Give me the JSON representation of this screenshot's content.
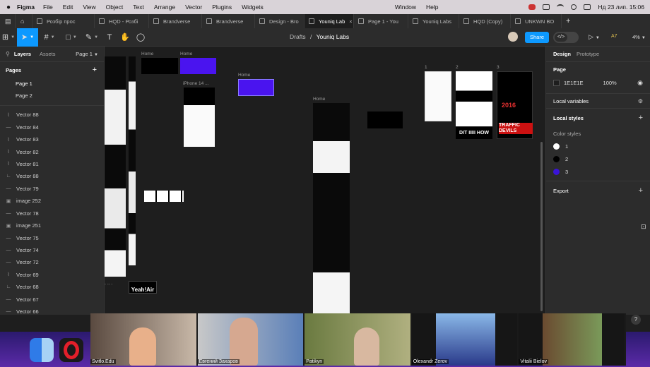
{
  "menubar": {
    "app": "Figma",
    "items": [
      "File",
      "Edit",
      "View",
      "Object",
      "Text",
      "Arrange",
      "Vector",
      "Plugins",
      "Widgets",
      "Window",
      "Help"
    ],
    "datetime": "Нд 23 лип.  15:06"
  },
  "tabs": [
    {
      "label": "Розбір прос",
      "active": false
    },
    {
      "label": "HQD - Розбі",
      "active": false
    },
    {
      "label": "Brandverse",
      "active": false
    },
    {
      "label": "Brandverse",
      "active": false
    },
    {
      "label": "Design - Bro",
      "active": false
    },
    {
      "label": "Youniq Lab",
      "active": true
    },
    {
      "label": "Page 1 - You",
      "active": false
    },
    {
      "label": "Youniq Labs",
      "active": false
    },
    {
      "label": "HQD (Copy)",
      "active": false
    },
    {
      "label": "UNKWN BO",
      "active": false
    }
  ],
  "toolbar": {
    "breadcrumb_parent": "Drafts",
    "breadcrumb_sep": "/",
    "breadcrumb_file": "Youniq Labs",
    "share_label": "Share",
    "code_label": "</>",
    "at_label": "A7",
    "zoom": "4%"
  },
  "left_panel": {
    "tab_layers": "Layers",
    "tab_assets": "Assets",
    "current_page": "Page 1",
    "pages_header": "Pages",
    "pages": [
      "Page 1",
      "Page 2"
    ],
    "layers": [
      {
        "icon": "⌇",
        "name": "Vector 88"
      },
      {
        "icon": "—",
        "name": "Vector 84"
      },
      {
        "icon": "⌇",
        "name": "Vector 83"
      },
      {
        "icon": "⌇",
        "name": "Vector 82"
      },
      {
        "icon": "⌇",
        "name": "Vector 81"
      },
      {
        "icon": "∟",
        "name": "Vector 88"
      },
      {
        "icon": "—",
        "name": "Vector 79"
      },
      {
        "icon": "▣",
        "name": "image 252"
      },
      {
        "icon": "—",
        "name": "Vector 78"
      },
      {
        "icon": "▣",
        "name": "image 251"
      },
      {
        "icon": "—",
        "name": "Vector 75"
      },
      {
        "icon": "—",
        "name": "Vector 74"
      },
      {
        "icon": "—",
        "name": "Vector 72"
      },
      {
        "icon": "⌇",
        "name": "Vector 69"
      },
      {
        "icon": "∟",
        "name": "Vector 68"
      },
      {
        "icon": "—",
        "name": "Vector 67"
      },
      {
        "icon": "—",
        "name": "Vector 66"
      },
      {
        "icon": "—",
        "name": "Vector 65"
      }
    ]
  },
  "canvas": {
    "labels": {
      "home1": "Home",
      "home2": "Home",
      "home3": "Home",
      "iphone": "iPhone 14 ...",
      "home_main": "Home",
      "n1": "1",
      "n2": "2",
      "n3": "3"
    },
    "yeah": "Yeah!Air",
    "dit": "DIT IIIII HOW",
    "traffic": "TRAFFIC DEVILS",
    "year": "2016"
  },
  "right_panel": {
    "tab_design": "Design",
    "tab_prototype": "Prototype",
    "page_header": "Page",
    "page_color": "1E1E1E",
    "page_opacity": "100%",
    "local_variables": "Local variables",
    "local_styles": "Local styles",
    "color_styles": "Color styles",
    "styles": [
      {
        "name": "1",
        "color": "#ffffff"
      },
      {
        "name": "2",
        "color": "#000000"
      },
      {
        "name": "3",
        "color": "#3a14d8"
      }
    ],
    "export": "Export"
  },
  "video_call": {
    "participants": [
      "Svitlo.Edu",
      "Евгений Захаров",
      "Patikyn",
      "Olexandr Zerov",
      "Vitalii Bielov"
    ]
  }
}
